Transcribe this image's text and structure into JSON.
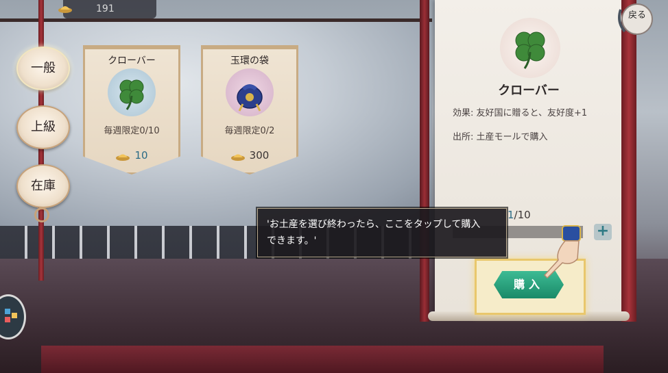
{
  "currency": {
    "icon": "gold-ingot-icon",
    "amount": "191"
  },
  "side_tabs": [
    {
      "label": "一般",
      "active": true
    },
    {
      "label": "上級",
      "active": false
    },
    {
      "label": "在庫",
      "active": false
    }
  ],
  "items": [
    {
      "name": "クローバー",
      "icon": "clover-icon",
      "limit": "毎週限定0/10",
      "price": "10"
    },
    {
      "name": "玉環の袋",
      "icon": "jade-ring-bag-icon",
      "limit": "毎週限定0/2",
      "price": "300"
    }
  ],
  "detail": {
    "name": "クローバー",
    "icon": "clover-icon",
    "effect": "効果: 友好国に贈ると、友好度+1",
    "source": "出所: 土産モールで購入",
    "quantity_current": "1",
    "quantity_max": "/10",
    "buy_label": "購入"
  },
  "tutorial": {
    "text": "'お土産を選び終わったら、ここをタップして購入\nできます。'"
  },
  "back_button": {
    "icon": "back-icon",
    "glyph": "戻る"
  },
  "colors": {
    "accent_green": "#1a8a68",
    "panel": "#f3efe9",
    "highlight": "#e9c76c"
  }
}
